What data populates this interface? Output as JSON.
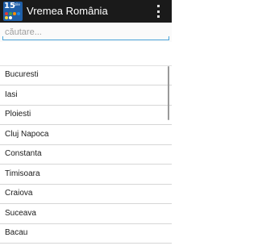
{
  "app": {
    "icon_number": "15",
    "icon_sup": "zile",
    "title": "Vremea România",
    "icon_colors": [
      "#e53935",
      "#43a047",
      "#fb8c00",
      "#1e88e5",
      "#fdd835",
      "#ffffff"
    ]
  },
  "search": {
    "placeholder": "căutare...",
    "value": ""
  },
  "cities": [
    "Bucuresti",
    "Iasi",
    "Ploiesti",
    "Cluj Napoca",
    "Constanta",
    "Timisoara",
    "Craiova",
    "Suceava",
    "Bacau"
  ]
}
